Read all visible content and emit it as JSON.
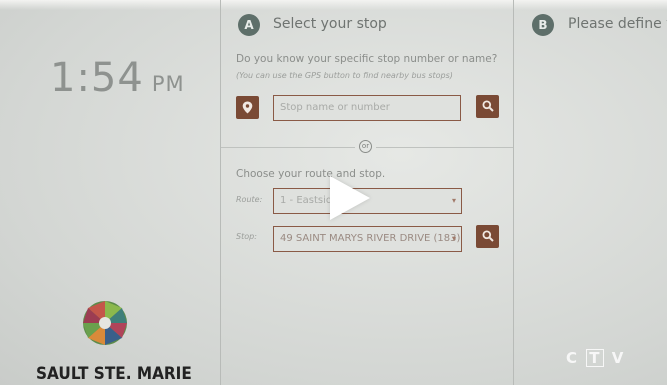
{
  "clock": {
    "time": "1:54",
    "ampm": "PM"
  },
  "branding": {
    "city_name": "SAULT STE. MARIE",
    "watermark": [
      "C",
      "T",
      "V"
    ]
  },
  "step_a": {
    "badge": "A",
    "title": "Select your stop",
    "question": "Do you know your specific stop number or name?",
    "hint": "(You can use the GPS button to find nearby bus stops)",
    "search_placeholder": "Stop name or number",
    "or_label": "or",
    "choose_label": "Choose your route and stop.",
    "route_label": "Route:",
    "route_value": "1 - Eastside",
    "stop_label": "Stop:",
    "stop_value": "49 SAINT MARYS RIVER DRIVE (183)"
  },
  "step_b": {
    "badge": "B",
    "title": "Please define y"
  },
  "colors": {
    "accent": "#7a4a35",
    "badge": "#5e6f6a"
  },
  "icons": [
    "location-pin-icon",
    "search-icon",
    "chevron-down-icon",
    "play-icon"
  ]
}
